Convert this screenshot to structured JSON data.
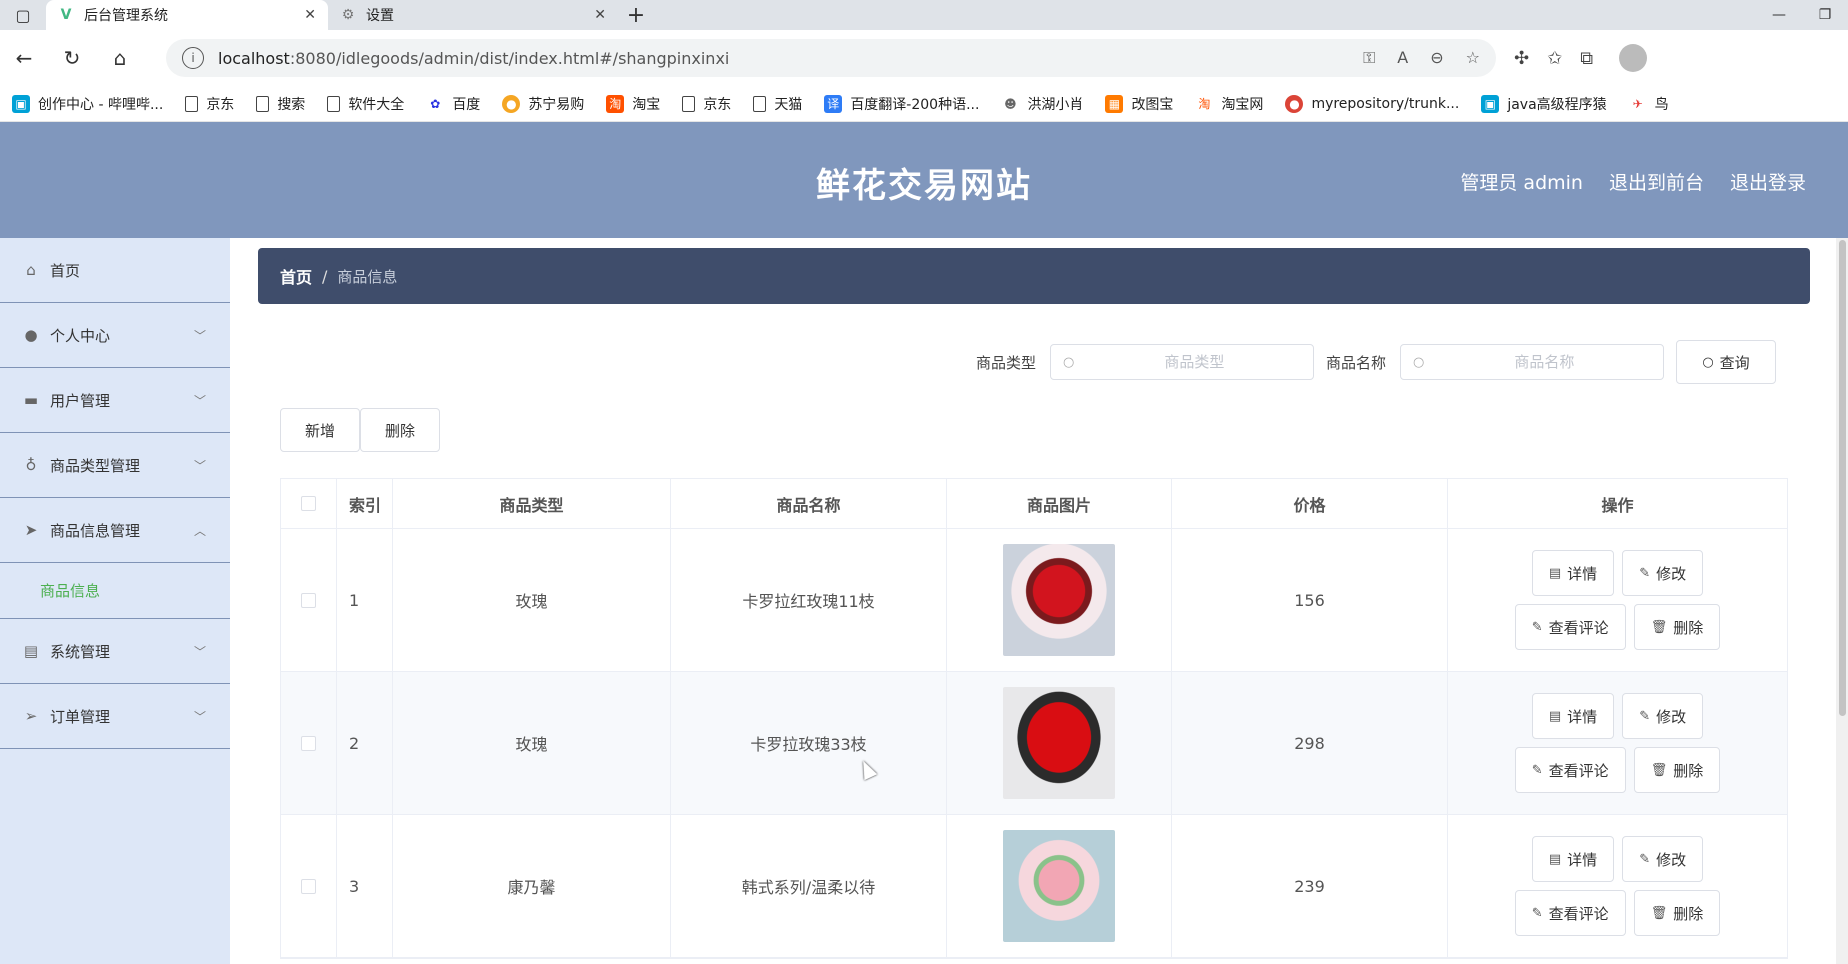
{
  "browser": {
    "tabs": [
      {
        "title": "后台管理系统",
        "active": true
      },
      {
        "title": "设置",
        "active": false
      }
    ],
    "url_host": "localhost",
    "url_path": ":8080/idlegoods/admin/dist/index.html#/shangpinxinxi",
    "bookmarks": [
      "创作中心 - 哔哩哔...",
      "京东",
      "搜索",
      "软件大全",
      "百度",
      "苏宁易购",
      "淘宝",
      "京东",
      "天猫",
      "百度翻译-200种语...",
      "洪湖小肖",
      "改图宝",
      "淘宝网",
      "myrepository/trunk...",
      "java高级程序猿",
      "鸟"
    ]
  },
  "header": {
    "title": "鲜花交易网站",
    "links": [
      "管理员 admin",
      "退出到前台",
      "退出登录"
    ]
  },
  "sidebar": {
    "items": [
      {
        "label": "首页",
        "icon": "home-icon",
        "expandable": false
      },
      {
        "label": "个人中心",
        "icon": "user-icon",
        "expandable": true
      },
      {
        "label": "用户管理",
        "icon": "wallet-icon",
        "expandable": true
      },
      {
        "label": "商品类型管理",
        "icon": "microphone-icon",
        "expandable": true
      },
      {
        "label": "商品信息管理",
        "icon": "send-icon",
        "expandable": true,
        "expanded": true,
        "children": [
          "商品信息"
        ]
      },
      {
        "label": "系统管理",
        "icon": "clipboard-icon",
        "expandable": true
      },
      {
        "label": "订单管理",
        "icon": "location-icon",
        "expandable": true
      }
    ]
  },
  "breadcrumb": {
    "home": "首页",
    "separator": "/",
    "current": "商品信息"
  },
  "search": {
    "type_label": "商品类型",
    "type_placeholder": "商品类型",
    "name_label": "商品名称",
    "name_placeholder": "商品名称",
    "query_label": "查询"
  },
  "actions": {
    "add_label": "新增",
    "delete_label": "删除"
  },
  "table": {
    "columns": [
      "索引",
      "商品类型",
      "商品名称",
      "商品图片",
      "价格",
      "操作"
    ],
    "rows": [
      {
        "index": "1",
        "type": "玫瑰",
        "name": "卡罗拉红玫瑰11枝",
        "price": "156"
      },
      {
        "index": "2",
        "type": "玫瑰",
        "name": "卡罗拉玫瑰33枝",
        "price": "298"
      },
      {
        "index": "3",
        "type": "康乃馨",
        "name": "韩式系列/温柔以待",
        "price": "239"
      }
    ],
    "ops": {
      "detail": "详情",
      "edit": "修改",
      "comments": "查看评论",
      "delete": "删除"
    }
  }
}
